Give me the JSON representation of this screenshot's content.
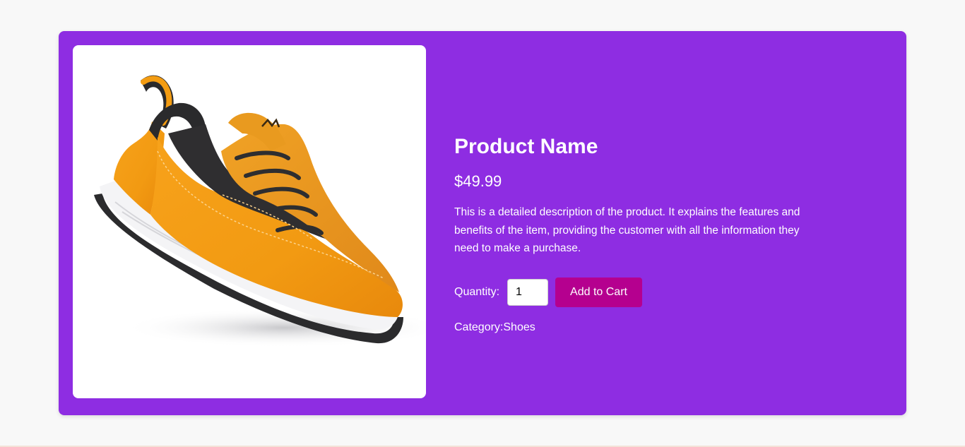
{
  "product": {
    "image_alt": "shoe-image",
    "name": "Product Name",
    "price": "$49.99",
    "description": "This is a detailed description of the product. It explains the features and benefits of the item, providing the customer with all the information they need to make a purchase.",
    "quantity_label": "Quantity:",
    "quantity_value": "1",
    "add_to_cart_label": "Add to Cart",
    "category_label": "Category:",
    "category_value": "Shoes"
  },
  "colors": {
    "page_background": "#f8f8f8",
    "card_background": "#8e2de2",
    "button_background": "#b5008f",
    "text": "#ffffff"
  }
}
